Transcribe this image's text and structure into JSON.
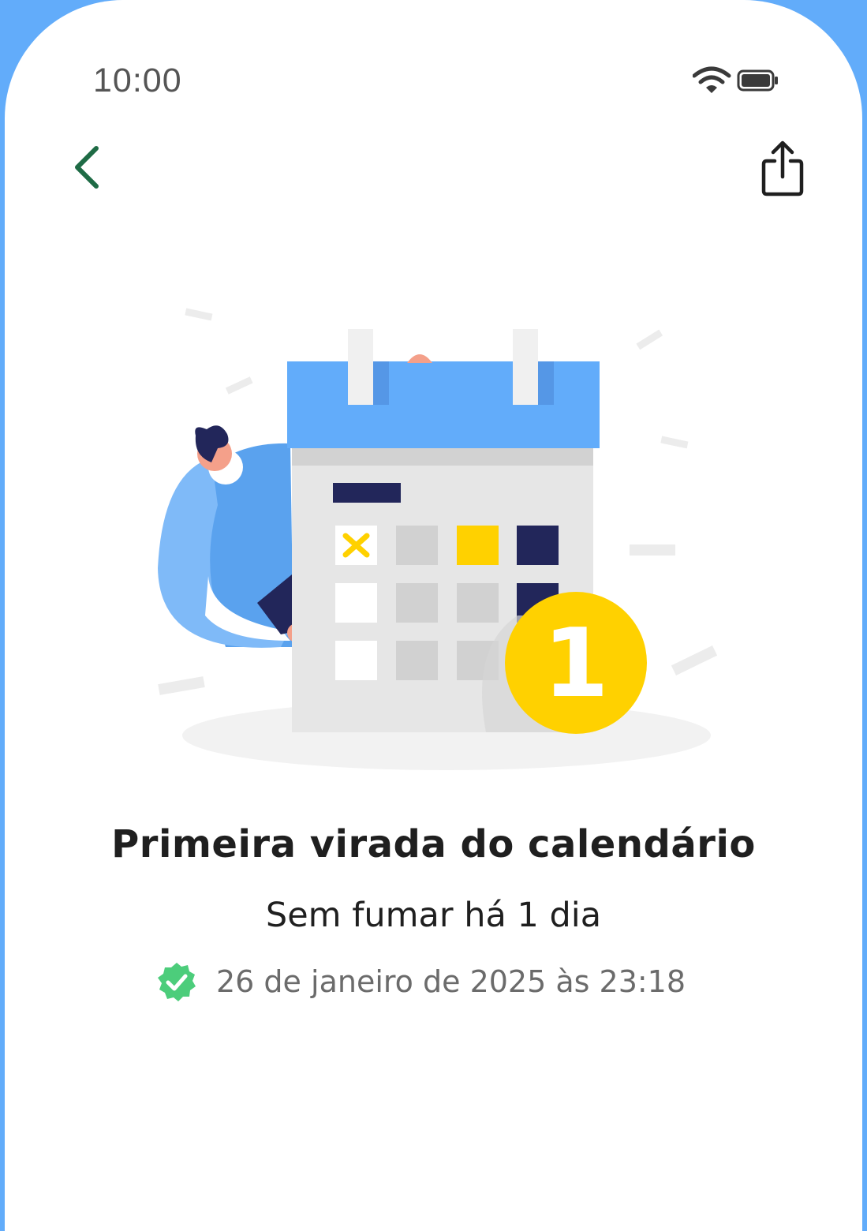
{
  "status_bar": {
    "time": "10:00",
    "icons": [
      "wifi-icon",
      "battery-icon"
    ]
  },
  "nav": {
    "back_icon": "chevron-left-icon",
    "share_icon": "share-icon"
  },
  "illustration": {
    "badge_number": "1"
  },
  "achievement": {
    "title": "Primeira virada do calendário",
    "subtitle": "Sem fumar há 1 dia",
    "date": "26 de janeiro de 2025 às 23:18",
    "verified_icon": "verified-check-icon"
  },
  "colors": {
    "background_frame": "#62acfa",
    "accent_green": "#1e6b45",
    "calendar_blue": "#62acfa",
    "badge_yellow": "#ffd100",
    "navy": "#22265a",
    "verified_green": "#4ccd7b"
  }
}
